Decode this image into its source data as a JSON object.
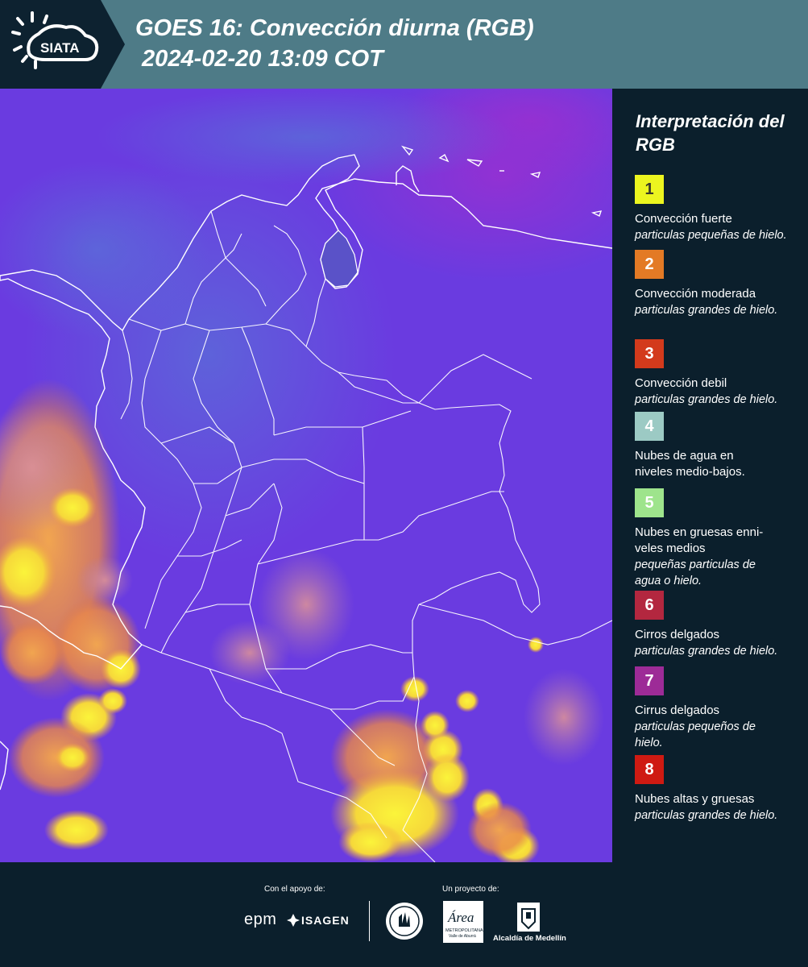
{
  "header": {
    "logo_text": "SIATA",
    "title_line1": "GOES 16: Convección diurna (RGB)",
    "title_line2": " 2024-02-20 13:09 COT",
    "colors": {
      "bar": "#4e7b87",
      "logo_panel": "#0d2230"
    }
  },
  "legend": {
    "title": "Interpretación del RGB",
    "items": [
      {
        "number": "1",
        "color": "#ecf51f",
        "number_color": "#3a3a2a",
        "label": "Convección fuerte",
        "desc": "particulas pequeñas de hielo."
      },
      {
        "number": "2",
        "color": "#e37a25",
        "number_color": "#ffffff",
        "label": "Convección moderada",
        "desc": "particulas grandes de hielo."
      },
      {
        "number": "3",
        "color": "#d33a1c",
        "number_color": "#ffffff",
        "label": "Convección debil",
        "desc": "particulas grandes de hielo."
      },
      {
        "number": "4",
        "color": "#9ccac4",
        "number_color": "#ffffff",
        "label": "Nubes de agua en niveles medio-bajos.",
        "desc": ""
      },
      {
        "number": "5",
        "color": "#9ee48c",
        "number_color": "#ffffff",
        "label": "Nubes en gruesas enni-veles medios",
        "desc": "pequeñas particulas de agua o hielo."
      },
      {
        "number": "6",
        "color": "#b3273f",
        "number_color": "#ffffff",
        "label": "Cirros delgados",
        "desc": "particulas grandes de hielo."
      },
      {
        "number": "7",
        "color": "#9d2b97",
        "number_color": "#ffffff",
        "label": "Cirrus delgados",
        "desc": "particulas pequeños de hielo."
      },
      {
        "number": "8",
        "color": "#cf1a12",
        "number_color": "#ffffff",
        "label": "Nubes altas y gruesas",
        "desc": "particulas grandes de hielo."
      }
    ]
  },
  "footer": {
    "support_label": "Con el apoyo de:",
    "project_label": "Un proyecto de:",
    "sponsors": {
      "epm": "epm",
      "isagen": "ISAGEN"
    },
    "partners": {
      "area_logo": "Área",
      "area_sub": "METROPOLITANA",
      "area_sub2": "Valle de Aburrá",
      "alcaldia": "Alcaldía de Medellín"
    }
  },
  "map": {
    "colors": {
      "sea_background": "#6a3be0",
      "land_tint": "#5a46d8",
      "cloud_yellow": "#f6ea2a",
      "cloud_orange": "#ef9a45",
      "boundary": "#ffffff"
    }
  }
}
